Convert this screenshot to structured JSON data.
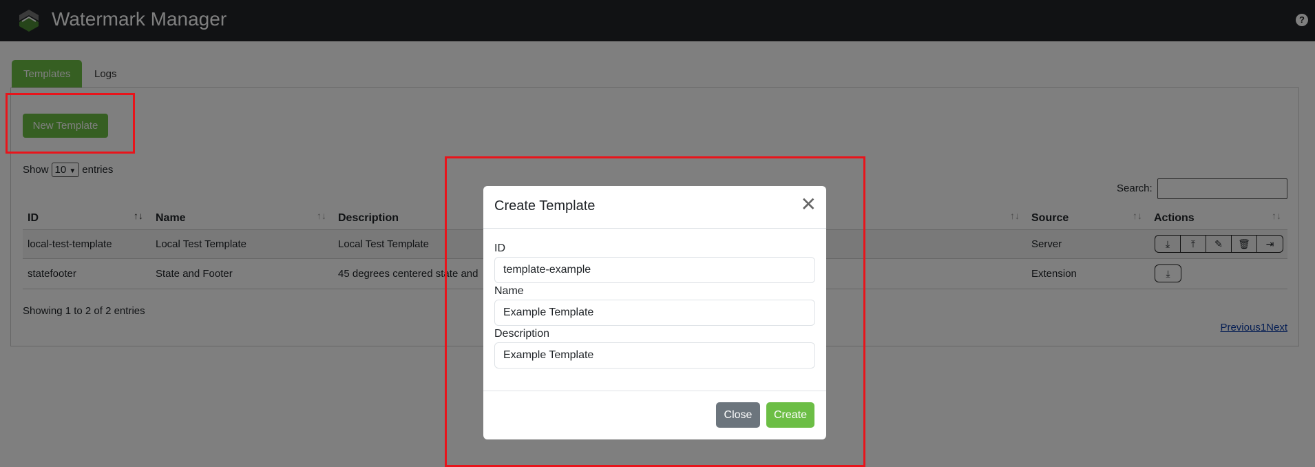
{
  "header": {
    "title": "Watermark Manager",
    "help_icon": "question-circle-icon"
  },
  "tabs": [
    {
      "label": "Templates",
      "active": true
    },
    {
      "label": "Logs",
      "active": false
    }
  ],
  "toolbar": {
    "new_template_label": "New Template"
  },
  "length": {
    "prefix": "Show",
    "value": "10",
    "suffix": "entries"
  },
  "search": {
    "label": "Search:",
    "value": ""
  },
  "table": {
    "columns": [
      "ID",
      "Name",
      "Description",
      "Source",
      "Actions"
    ],
    "rows": [
      {
        "id": "local-test-template",
        "name": "Local Test Template",
        "description": "Local Test Template",
        "source": "Server",
        "actions": [
          "download",
          "upload",
          "edit",
          "delete",
          "export"
        ]
      },
      {
        "id": "statefooter",
        "name": "State and Footer",
        "description": "45 degrees centered state and",
        "source": "Extension",
        "actions": [
          "download"
        ]
      }
    ]
  },
  "info": "Showing 1 to 2 of 2 entries",
  "pagination": {
    "previous": "Previous",
    "page": "1",
    "next": "Next"
  },
  "modal": {
    "title": "Create Template",
    "fields": [
      {
        "label": "ID",
        "value": "template-example"
      },
      {
        "label": "Name",
        "value": "Example Template"
      },
      {
        "label": "Description",
        "value": "Example Template"
      }
    ],
    "close_label": "Close",
    "create_label": "Create"
  },
  "colors": {
    "accent": "#6cbe45",
    "highlight": "#e8141b",
    "secondary": "#6c757d"
  }
}
